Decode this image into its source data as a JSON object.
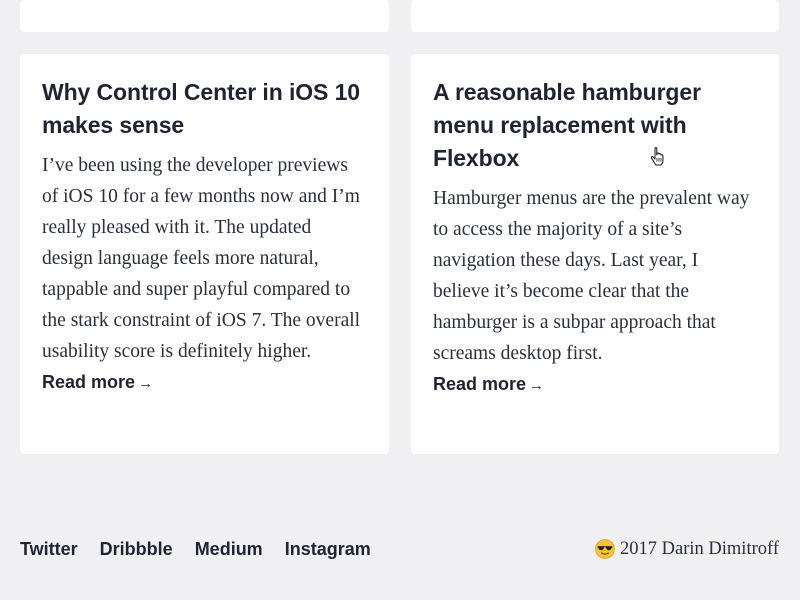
{
  "posts": [
    {
      "title": "Why Control Center in iOS 10 makes sense",
      "excerpt": "I’ve been using the developer previews of iOS 10 for a few months now and I’m really pleased with it. The updated design language feels more natural, tappable and super playful compared to the stark constraint of iOS 7. The overall usability score is definitely higher.",
      "read_more": "Read more"
    },
    {
      "title": "A reasonable hamburger menu replacement with Flexbox",
      "excerpt": "Hamburger menus are the prevalent way to access the majority of a site’s navigation these days. Last year, I believe it’s become clear that the hamburger is a subpar approach that screams desktop first.",
      "read_more": "Read more"
    }
  ],
  "footer": {
    "links": [
      "Twitter",
      "Dribbble",
      "Medium",
      "Instagram"
    ],
    "copyright": "2017 Darin Dimitroff",
    "copyright_icon": "sunglasses-emoji-icon"
  },
  "icons": {
    "read_more_arrow": "arrow-right-icon",
    "cursor": "hand-pointer-cursor-icon"
  },
  "colors": {
    "background": "#f0f0f3",
    "card": "#ffffff",
    "text": "#1f2433"
  }
}
